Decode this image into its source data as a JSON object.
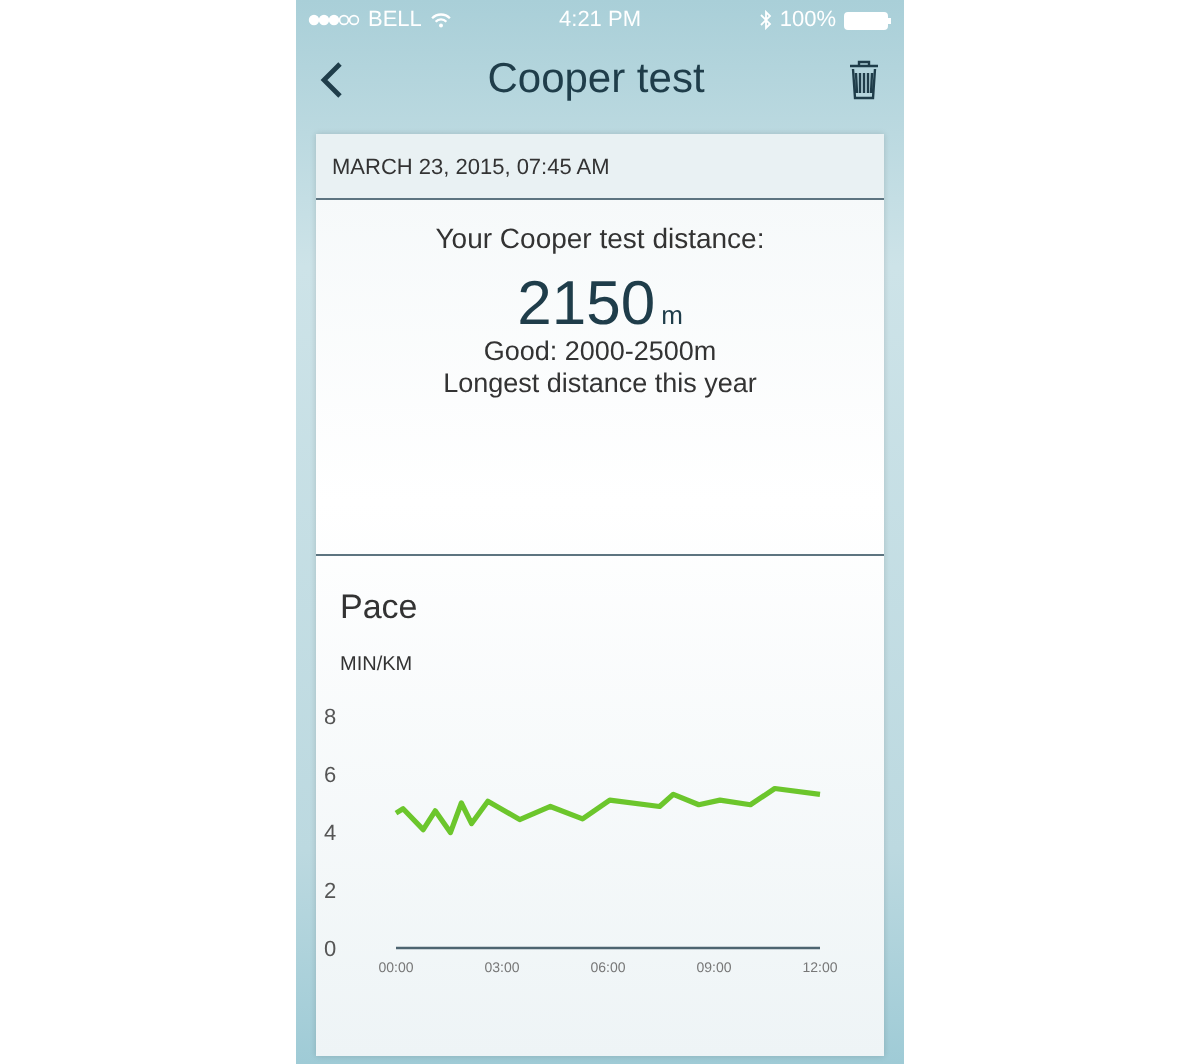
{
  "status_bar": {
    "carrier": "BELL",
    "time": "4:21 PM",
    "battery": "100%"
  },
  "nav": {
    "title": "Cooper test"
  },
  "result": {
    "date": "MARCH 23, 2015, 07:45 AM",
    "heading": "Your Cooper test distance:",
    "distance": "2150",
    "unit": "m",
    "rating": "Good: 2000-2500m",
    "note": "Longest distance this year"
  },
  "pace": {
    "title": "Pace",
    "chart_data": {
      "type": "line",
      "ylabel": "MIN/KM",
      "x": [
        0,
        0.2,
        0.77,
        1.11,
        1.54,
        1.85,
        2.14,
        2.6,
        3.5,
        4.37,
        5.28,
        6.05,
        7.46,
        7.85,
        8.57,
        9.17,
        10.03,
        10.72,
        12
      ],
      "series": [
        {
          "color": "#6cc62c",
          "values": [
            4.65,
            4.8,
            4.08,
            4.73,
            3.98,
            5.0,
            4.29,
            5.06,
            4.43,
            4.88,
            4.45,
            5.1,
            4.88,
            5.3,
            4.94,
            5.1,
            4.94,
            5.5,
            5.3
          ]
        }
      ],
      "xlim": [
        0,
        12
      ],
      "ylim": [
        0,
        8
      ],
      "yticks": [
        0,
        2,
        4,
        6,
        8
      ],
      "xticks": [
        {
          "value": 0,
          "label": "00:00"
        },
        {
          "value": 3,
          "label": "03:00"
        },
        {
          "value": 6,
          "label": "06:00"
        },
        {
          "value": 9,
          "label": "09:00"
        },
        {
          "value": 12,
          "label": "12:00"
        }
      ]
    }
  }
}
